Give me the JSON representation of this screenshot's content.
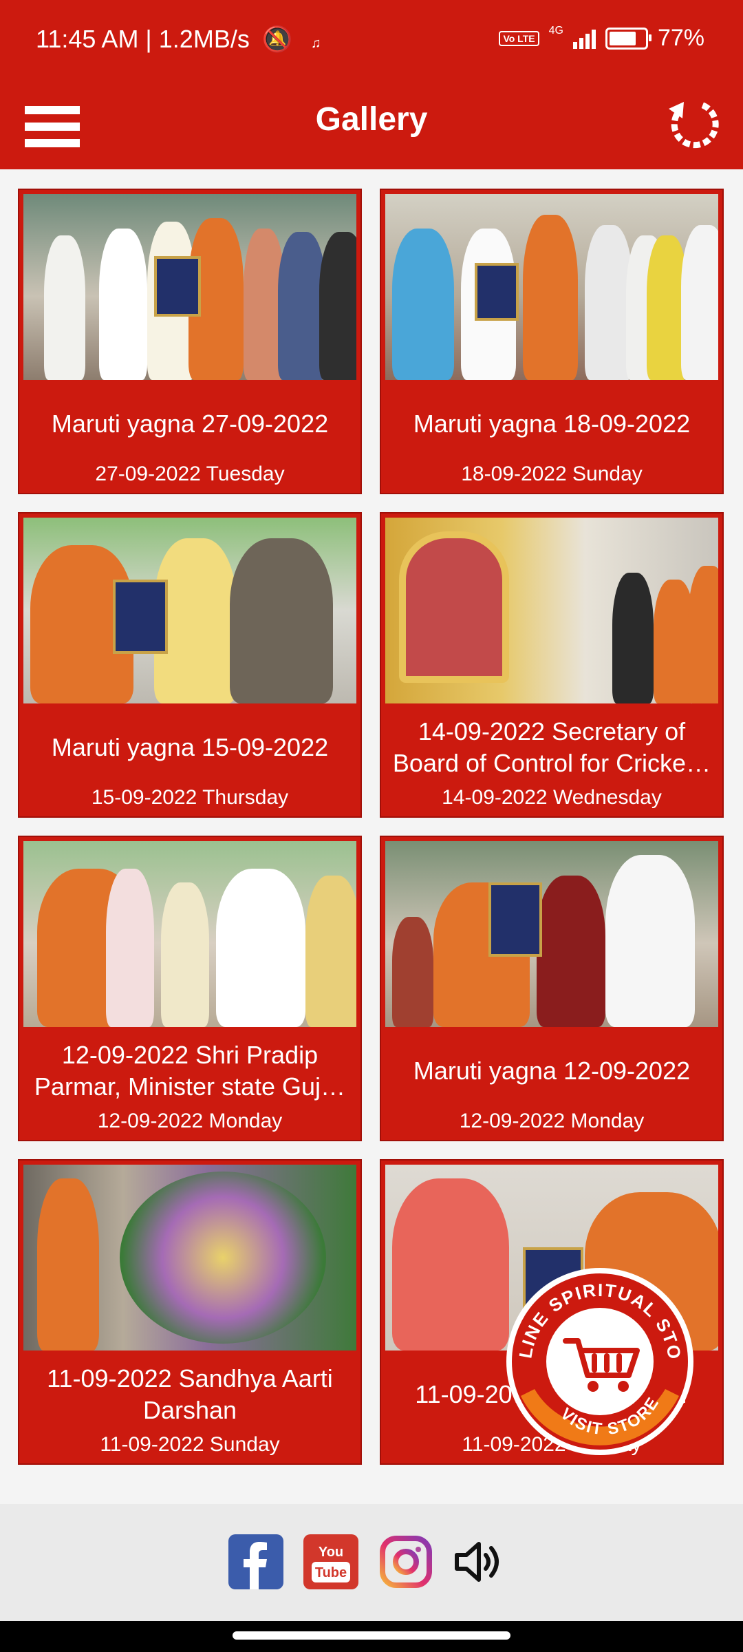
{
  "status": {
    "time_text": "11:45 AM | 1.2MB/s",
    "network": "4G",
    "battery": "77%",
    "battery_level": 0.77,
    "volte": "Vo LTE"
  },
  "appbar": {
    "title": "Gallery"
  },
  "gallery": [
    {
      "title": "Maruti yagna 27-09-2022",
      "date": "27-09-2022 Tuesday"
    },
    {
      "title": "Maruti yagna 18-09-2022",
      "date": "18-09-2022 Sunday"
    },
    {
      "title": "Maruti yagna 15-09-2022",
      "date": "15-09-2022 Thursday"
    },
    {
      "title": "14-09-2022 Secretary of Board of Control for Cricke…",
      "date": "14-09-2022 Wednesday"
    },
    {
      "title": "12-09-2022 Shri Pradip Parmar, Minister state Guj…",
      "date": "12-09-2022 Monday"
    },
    {
      "title": "Maruti yagna 12-09-2022",
      "date": "12-09-2022 Monday"
    },
    {
      "title": "11-09-2022 Sandhya Aarti Darshan",
      "date": "11-09-2022 Sunday"
    },
    {
      "title": "11-09-20… Shiyal At S…",
      "date": "11-09-2022 Sunday"
    }
  ],
  "store_badge": {
    "top_text": "ONLINE SPIRITUAL STORE",
    "bottom_text": "VISIT STORE"
  },
  "footer": {
    "icons": [
      "facebook-icon",
      "youtube-icon",
      "instagram-icon",
      "speaker-icon"
    ],
    "youtube_you": "You",
    "youtube_tube": "Tube"
  },
  "colors": {
    "primary": "#cc1a0f",
    "accent_orange": "#f07a17"
  }
}
